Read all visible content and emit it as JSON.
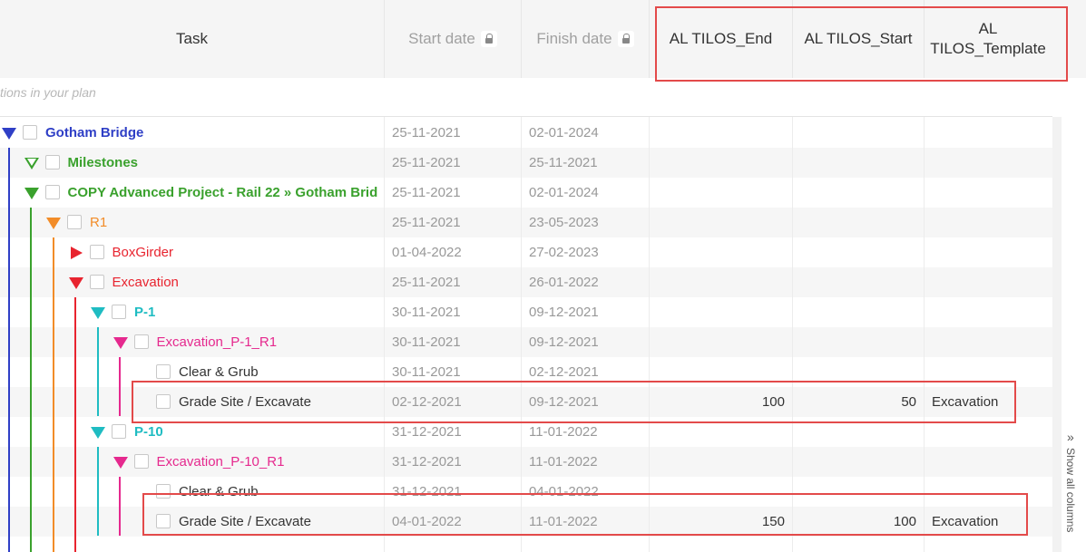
{
  "header": {
    "task": "Task",
    "start_date": "Start date",
    "finish_date": "Finish date",
    "al_end": "AL TILOS_End",
    "al_start": "AL TILOS_Start",
    "al_template": "AL\nTILOS_Template"
  },
  "hint": "tions in your plan",
  "show_all": "Show all columns",
  "colors": {
    "blue": "#2f3fc6",
    "green": "#3aa12d",
    "orange": "#f28c28",
    "red": "#e8242f",
    "teal": "#1fbcc2",
    "pink": "#e5298e",
    "highlight": "#e34a4a"
  },
  "rows": [
    {
      "name": "Gotham Bridge",
      "start": "25-11-2021",
      "finish": "02-01-2024",
      "end": "",
      "startv": "",
      "template": ""
    },
    {
      "name": "Milestones",
      "start": "25-11-2021",
      "finish": "25-11-2021",
      "end": "",
      "startv": "",
      "template": ""
    },
    {
      "name": "COPY Advanced Project - Rail 22 » Gotham Brid",
      "start": "25-11-2021",
      "finish": "02-01-2024",
      "end": "",
      "startv": "",
      "template": ""
    },
    {
      "name": "R1",
      "start": "25-11-2021",
      "finish": "23-05-2023",
      "end": "",
      "startv": "",
      "template": ""
    },
    {
      "name": "BoxGirder",
      "start": "01-04-2022",
      "finish": "27-02-2023",
      "end": "",
      "startv": "",
      "template": ""
    },
    {
      "name": "Excavation",
      "start": "25-11-2021",
      "finish": "26-01-2022",
      "end": "",
      "startv": "",
      "template": ""
    },
    {
      "name": "P-1",
      "start": "30-11-2021",
      "finish": "09-12-2021",
      "end": "",
      "startv": "",
      "template": ""
    },
    {
      "name": "Excavation_P-1_R1",
      "start": "30-11-2021",
      "finish": "09-12-2021",
      "end": "",
      "startv": "",
      "template": ""
    },
    {
      "name": "Clear & Grub",
      "start": "30-11-2021",
      "finish": "02-12-2021",
      "end": "",
      "startv": "",
      "template": ""
    },
    {
      "name": "Grade Site / Excavate",
      "start": "02-12-2021",
      "finish": "09-12-2021",
      "end": "100",
      "startv": "50",
      "template": "Excavation"
    },
    {
      "name": "P-10",
      "start": "31-12-2021",
      "finish": "11-01-2022",
      "end": "",
      "startv": "",
      "template": ""
    },
    {
      "name": "Excavation_P-10_R1",
      "start": "31-12-2021",
      "finish": "11-01-2022",
      "end": "",
      "startv": "",
      "template": ""
    },
    {
      "name": "Clear & Grub",
      "start": "31-12-2021",
      "finish": "04-01-2022",
      "end": "",
      "startv": "",
      "template": ""
    },
    {
      "name": "Grade Site / Excavate",
      "start": "04-01-2022",
      "finish": "11-01-2022",
      "end": "150",
      "startv": "100",
      "template": "Excavation"
    }
  ]
}
